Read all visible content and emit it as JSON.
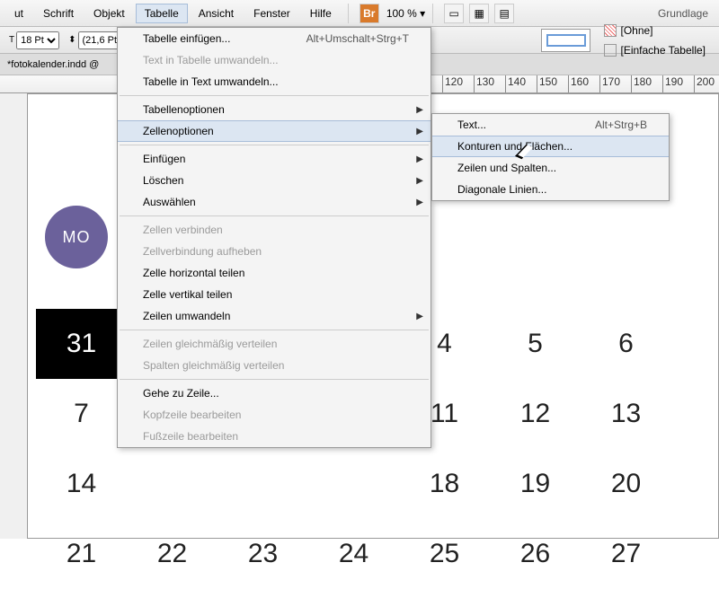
{
  "menubar": {
    "items": [
      "ut",
      "Schrift",
      "Objekt",
      "Tabelle",
      "Ansicht",
      "Fenster",
      "Hilfe"
    ],
    "active_index": 3,
    "br_label": "Br",
    "zoom": "100 % ▾",
    "right": "Grundlage"
  },
  "toolbar": {
    "font_size": "18 Pt",
    "leading": "(21,6 Pt)",
    "style_none": "[Ohne]",
    "style_simple": "[Einfache Tabelle]"
  },
  "tab": {
    "label": "*fotokalender.indd @"
  },
  "ruler": {
    "ticks": [
      "120",
      "130",
      "140",
      "150",
      "160",
      "170",
      "180",
      "190",
      "200"
    ]
  },
  "badge": {
    "label": "MO"
  },
  "calendar": {
    "rows": [
      [
        "31",
        "",
        "",
        "",
        "4",
        "5",
        "6"
      ],
      [
        "7",
        "",
        "",
        "",
        "11",
        "12",
        "13"
      ],
      [
        "14",
        "",
        "",
        "",
        "18",
        "19",
        "20"
      ],
      [
        "21",
        "22",
        "23",
        "24",
        "25",
        "26",
        "27"
      ]
    ],
    "dark_cell": "31"
  },
  "menu_main": [
    {
      "label": "Tabelle einfügen...",
      "shortcut": "Alt+Umschalt+Strg+T"
    },
    {
      "label": "Text in Tabelle umwandeln...",
      "disabled": true
    },
    {
      "label": "Tabelle in Text umwandeln..."
    },
    {
      "sep": true
    },
    {
      "label": "Tabellenoptionen",
      "sub": true
    },
    {
      "label": "Zellenoptionen",
      "sub": true,
      "highlight": true
    },
    {
      "sep": true
    },
    {
      "label": "Einfügen",
      "sub": true
    },
    {
      "label": "Löschen",
      "sub": true
    },
    {
      "label": "Auswählen",
      "sub": true
    },
    {
      "sep": true
    },
    {
      "label": "Zellen verbinden",
      "disabled": true
    },
    {
      "label": "Zellverbindung aufheben",
      "disabled": true
    },
    {
      "label": "Zelle horizontal teilen"
    },
    {
      "label": "Zelle vertikal teilen"
    },
    {
      "label": "Zeilen umwandeln",
      "sub": true
    },
    {
      "sep": true
    },
    {
      "label": "Zeilen gleichmäßig verteilen",
      "disabled": true
    },
    {
      "label": "Spalten gleichmäßig verteilen",
      "disabled": true
    },
    {
      "sep": true
    },
    {
      "label": "Gehe zu Zeile..."
    },
    {
      "label": "Kopfzeile bearbeiten",
      "disabled": true
    },
    {
      "label": "Fußzeile bearbeiten",
      "disabled": true
    }
  ],
  "menu_sub": [
    {
      "label": "Text...",
      "shortcut": "Alt+Strg+B"
    },
    {
      "label": "Konturen und Flächen...",
      "highlight": true
    },
    {
      "label": "Zeilen und Spalten..."
    },
    {
      "label": "Diagonale Linien..."
    }
  ]
}
